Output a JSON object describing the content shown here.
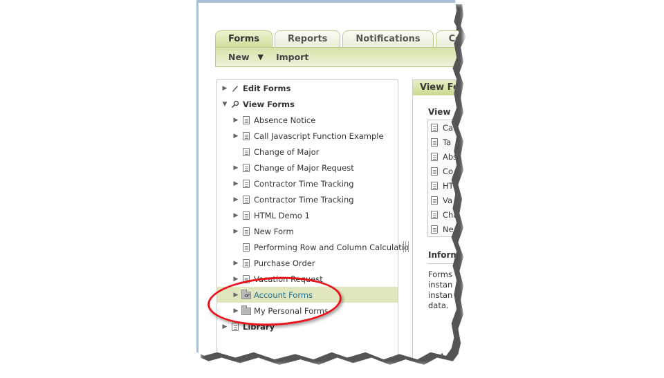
{
  "tabs": [
    {
      "label": "Forms",
      "active": true
    },
    {
      "label": "Reports",
      "active": false
    },
    {
      "label": "Notifications",
      "active": false
    },
    {
      "label": "Connect",
      "active": false
    }
  ],
  "toolbar": {
    "new_label": "New",
    "dropdown_glyph": "▼",
    "import_label": "Import"
  },
  "tree": {
    "top_nodes": [
      {
        "label": "Edit Forms",
        "icon": "pencil-icon",
        "expander": "▶"
      },
      {
        "label": "View Forms",
        "icon": "magnifier-icon",
        "expander": "▼"
      }
    ],
    "forms": [
      {
        "label": "Absence Notice",
        "expander": "▶",
        "icon": "document-icon"
      },
      {
        "label": "Call Javascript Function Example",
        "expander": "▶",
        "icon": "document-icon"
      },
      {
        "label": "Change of Major",
        "expander": "",
        "icon": "document-icon"
      },
      {
        "label": "Change of Major Request",
        "expander": "▶",
        "icon": "document-icon"
      },
      {
        "label": "Contractor Time Tracking",
        "expander": "▶",
        "icon": "document-icon"
      },
      {
        "label": "Contractor Time Tracking",
        "expander": "▶",
        "icon": "document-icon"
      },
      {
        "label": "HTML Demo 1",
        "expander": "▶",
        "icon": "document-icon"
      },
      {
        "label": "New Form",
        "expander": "▶",
        "icon": "document-icon"
      },
      {
        "label": "Performing Row and Column Calculatio",
        "expander": "",
        "icon": "document-icon"
      },
      {
        "label": "Purchase Order",
        "expander": "▶",
        "icon": "document-icon"
      },
      {
        "label": "Vacation Request",
        "expander": "▶",
        "icon": "document-icon"
      }
    ],
    "folders": [
      {
        "label": "Account Forms",
        "expander": "▶",
        "icon": "key-folder-icon",
        "selected": true
      },
      {
        "label": "My Personal Forms",
        "expander": "▶",
        "icon": "folder-icon",
        "selected": false
      }
    ],
    "library": {
      "label": "Library",
      "expander": "▶",
      "icon": "library-icon"
    }
  },
  "right_panel": {
    "header": "View Fo",
    "subhead": "View",
    "list_items": [
      "Call Ja",
      "Ta",
      "Abse",
      "Co",
      "HT",
      "Va",
      "Cha",
      "Ne"
    ],
    "info_title": "Informa",
    "info_text": "Forms\ninstan\ninstan\ndata.",
    "help_title": "Hel"
  },
  "annotation": {
    "color": "#e8141b",
    "target": "Account Forms / My Personal Forms"
  }
}
